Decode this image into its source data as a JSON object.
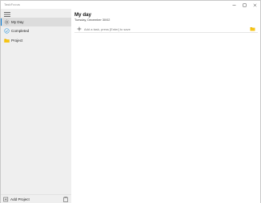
{
  "window": {
    "title": "TaskFocus",
    "controls": {
      "minimize": "minimize-icon",
      "maximize": "maximize-icon",
      "close": "close-icon"
    }
  },
  "sidebar": {
    "menu_icon": "hamburger-icon",
    "items": [
      {
        "label": "My Day",
        "icon": "sun-icon",
        "active": true
      },
      {
        "label": "Completed",
        "icon": "check-circle-icon",
        "active": false
      },
      {
        "label": "Project",
        "icon": "folder-icon",
        "active": false
      }
    ],
    "footer": {
      "add_label": "Add Project",
      "add_icon": "add-project-icon",
      "extra_icon": "clipboard-icon"
    }
  },
  "main": {
    "title": "My day",
    "date": "Tuesday, December 30/02",
    "task_input": {
      "placeholder": "Add a task, press [Enter] to save",
      "value": ""
    }
  },
  "colors": {
    "accent": "#0078d7",
    "sidebar_bg": "#efefef",
    "active_item_bg": "#dcdcdc",
    "folder": "#e8b100",
    "completed_icon": "#4aa3df"
  }
}
